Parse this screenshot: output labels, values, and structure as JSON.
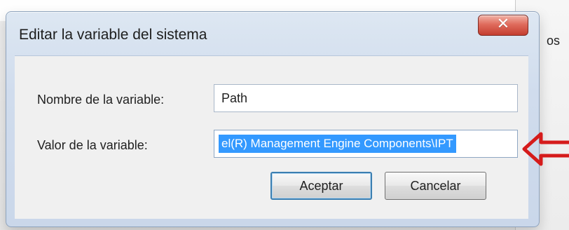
{
  "background": {
    "right_text": "os"
  },
  "dialog": {
    "title": "Editar la variable del sistema",
    "close_symbol": "✕",
    "fields": {
      "name_label": "Nombre de la variable:",
      "name_value": "Path",
      "value_label": "Valor de la variable:",
      "value_selected_text": "el(R) Management Engine Components\\IPT"
    },
    "buttons": {
      "accept": "Aceptar",
      "cancel": "Cancelar"
    }
  },
  "annotation": {
    "arrow_color": "#d51b1b",
    "icon": "arrow-left-icon"
  }
}
